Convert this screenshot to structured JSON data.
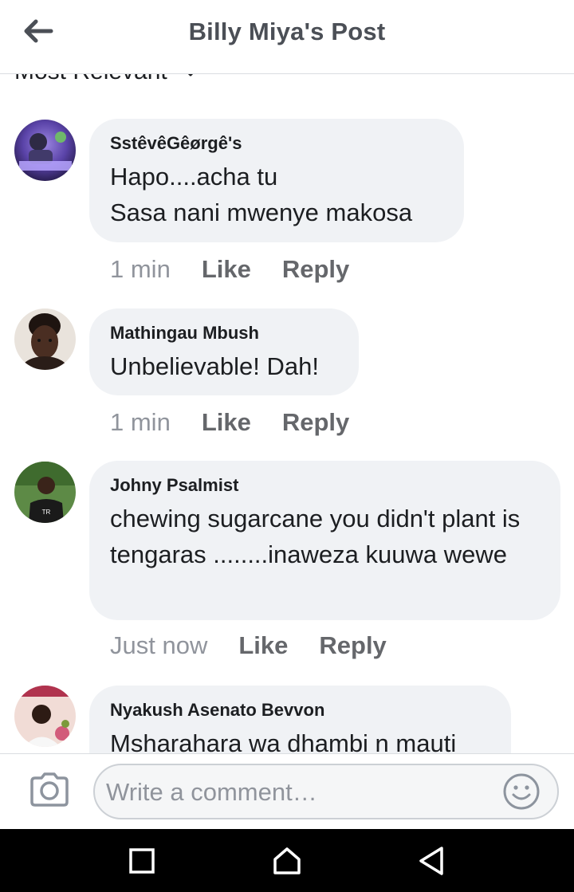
{
  "header": {
    "title": "Billy Miya's Post",
    "back_icon": "arrow-left-icon"
  },
  "sort": {
    "label": "Most Relevant",
    "icon": "chevron-down-icon"
  },
  "comments": [
    {
      "author": "SstêvêGêørgê's",
      "text": "Hapo....acha tu\nSasa nani mwenye makosa",
      "time": "1 min",
      "like": "Like",
      "reply": "Reply",
      "avatar_colors": [
        "#3d2f6e",
        "#7a5cc4"
      ]
    },
    {
      "author": "Mathingau Mbush",
      "text": "Unbelievable! Dah!",
      "time": "1 min",
      "like": "Like",
      "reply": "Reply",
      "avatar_colors": [
        "#2a1d18",
        "#c9b4a0"
      ]
    },
    {
      "author": "Johny Psalmist",
      "text": "chewing sugarcane you didn't  plant is tengaras ........inaweza kuuwa wewe",
      "time": "Just now",
      "like": "Like",
      "reply": "Reply",
      "avatar_colors": [
        "#3f6b2e",
        "#1d1d1d"
      ]
    },
    {
      "author": "Nyakush Asenato Bevvon",
      "text": "Msharahara wa dhambi n mauti",
      "avatar_colors": [
        "#d9a7a0",
        "#9c2f55"
      ]
    }
  ],
  "composer": {
    "placeholder": "Write a comment…",
    "camera_icon": "camera-icon",
    "emoji_icon": "smiley-icon"
  },
  "system_nav": {
    "recents_icon": "square-icon",
    "home_icon": "home-icon",
    "back_icon": "triangle-back-icon"
  },
  "colors": {
    "bubble": "#f0f2f5",
    "action_text": "#65676b",
    "title_text": "#4b4f56",
    "divider": "#dadde1"
  }
}
